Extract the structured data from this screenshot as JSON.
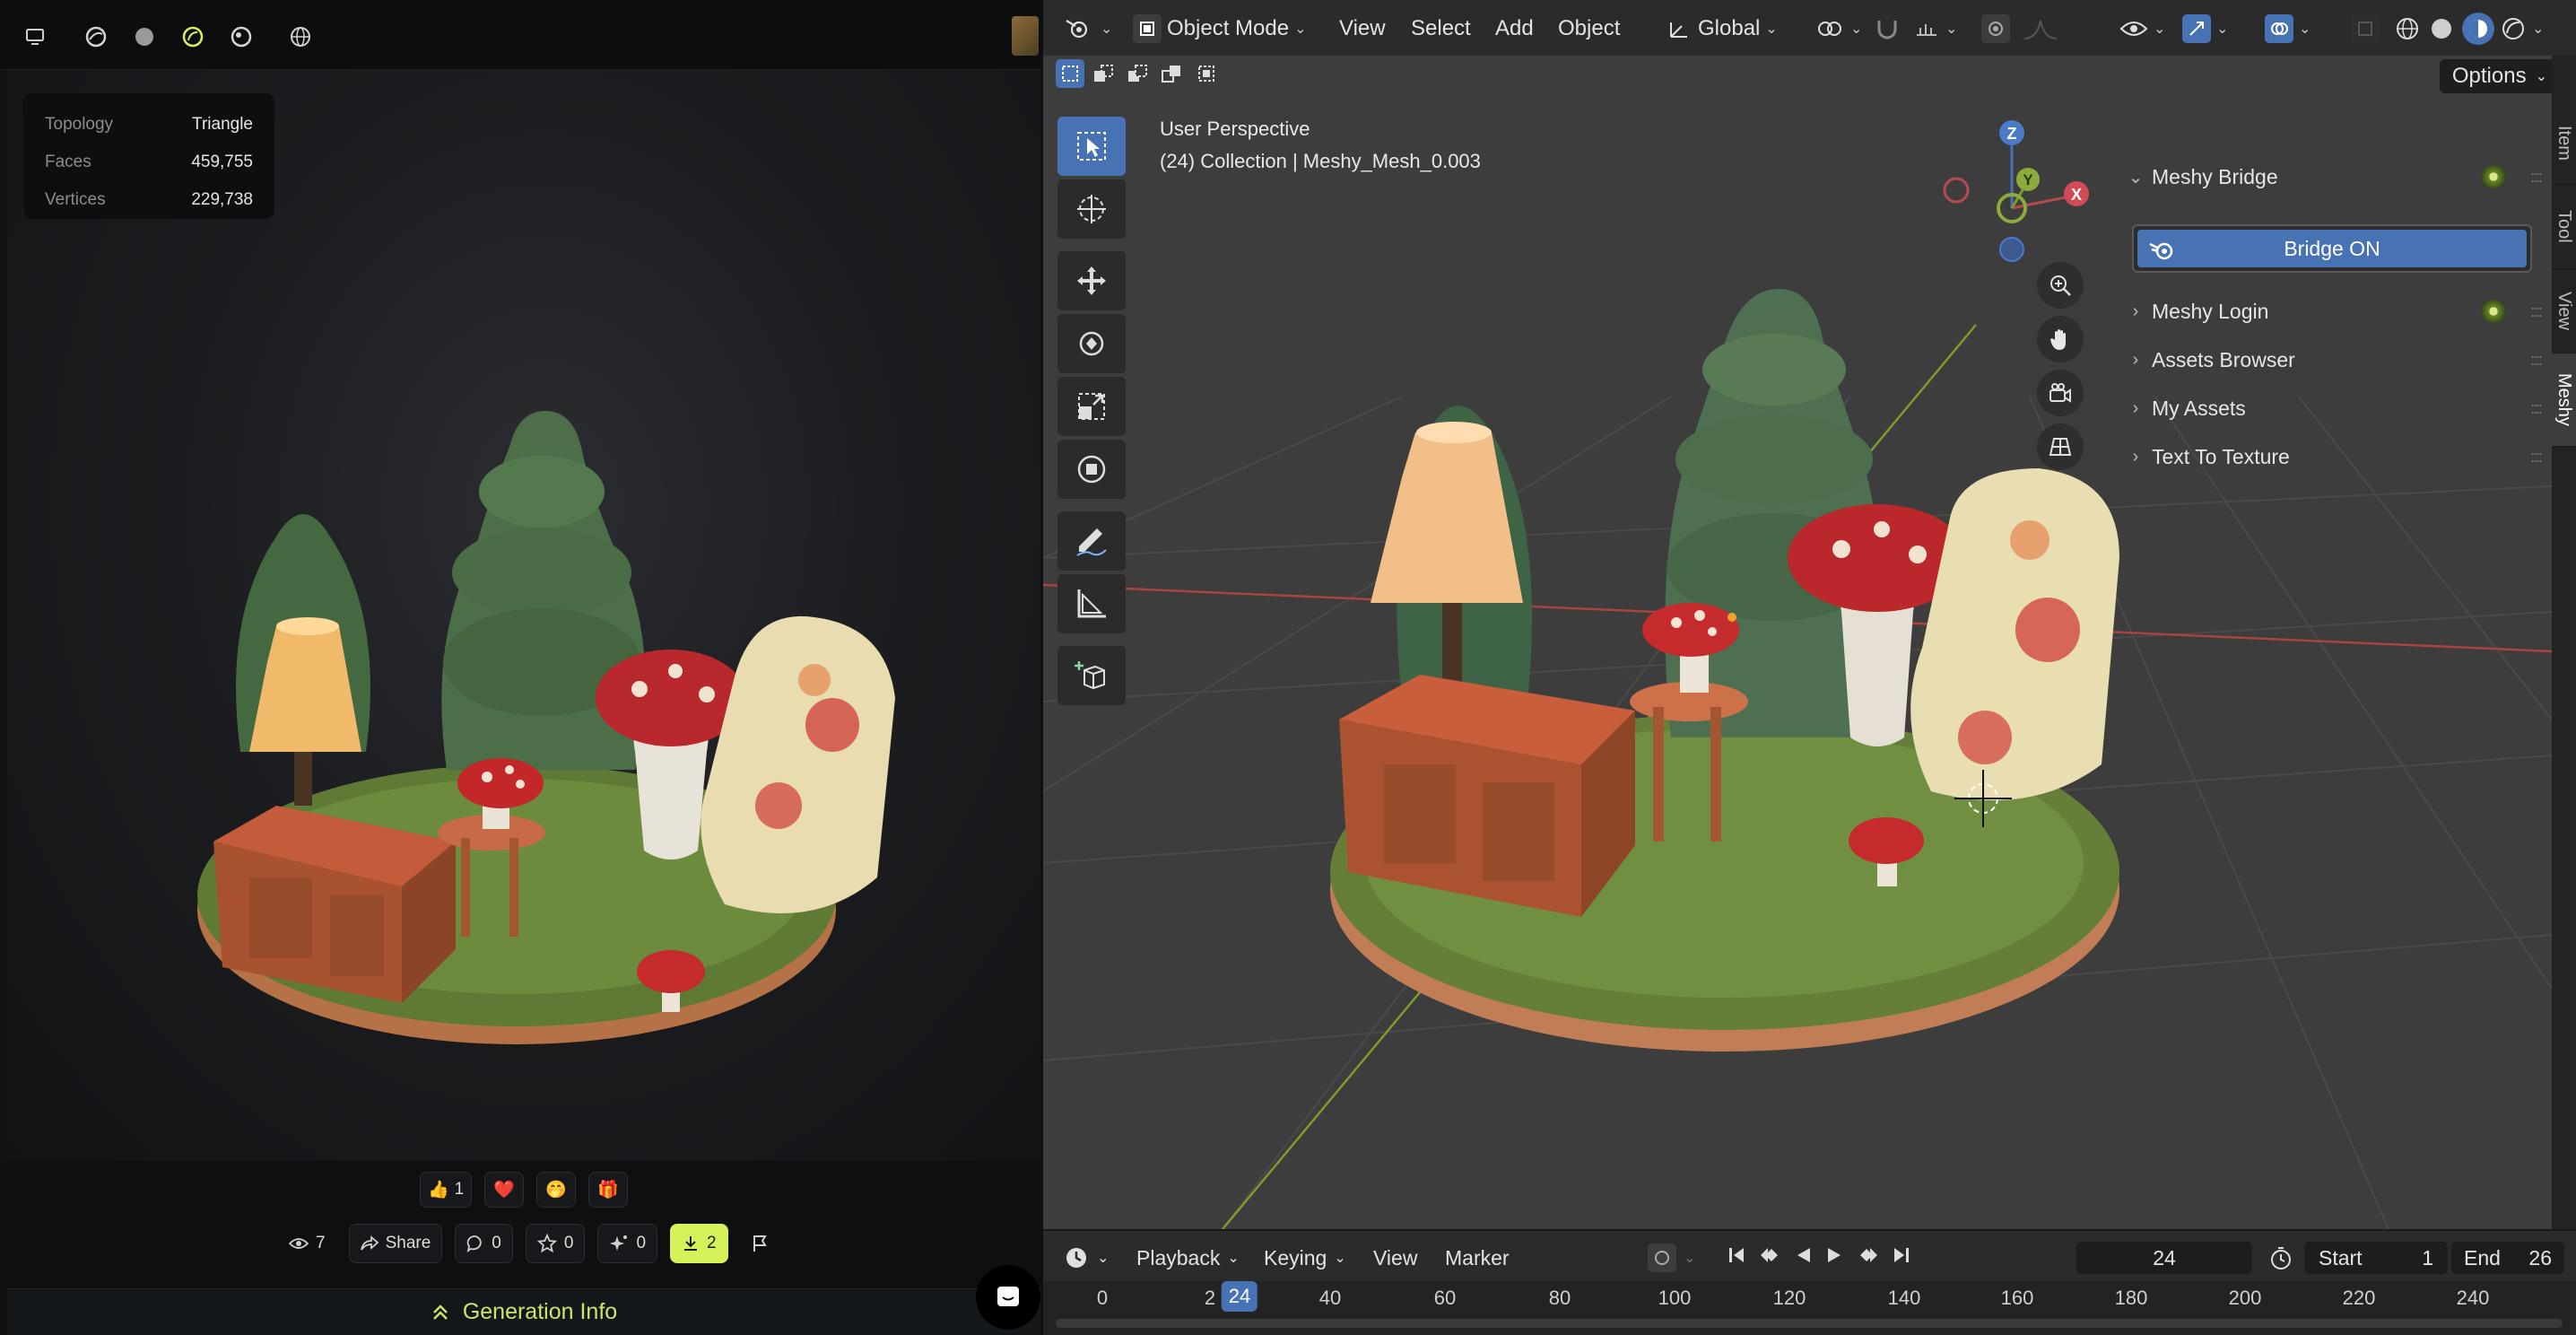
{
  "left": {
    "top_icons": [
      "monitor-icon",
      "render-mode-icon",
      "solid-mode-icon",
      "texture-mode-icon",
      "matcap-mode-icon",
      "wireframe-icon"
    ],
    "stats": [
      {
        "label": "Topology",
        "value": "Triangle"
      },
      {
        "label": "Faces",
        "value": "459,755"
      },
      {
        "label": "Vertices",
        "value": "229,738"
      }
    ],
    "reactions": [
      {
        "icon": "thumbs-up-icon",
        "glyph": "👍",
        "count": "1"
      },
      {
        "icon": "heart-icon",
        "glyph": "❤️",
        "count": ""
      },
      {
        "icon": "smile-icon",
        "glyph": "🤭",
        "count": ""
      },
      {
        "icon": "gift-icon",
        "glyph": "🎁",
        "count": ""
      }
    ],
    "actions": {
      "views": "7",
      "share": "Share",
      "comments": "0",
      "stars": "0",
      "remix": "0",
      "downloads": "2"
    },
    "generation_info": "Generation Info"
  },
  "blender": {
    "header": {
      "mode": "Object Mode",
      "menus": [
        "View",
        "Select",
        "Add",
        "Object"
      ],
      "orientation": "Global",
      "options": "Options"
    },
    "viewport": {
      "perspective": "User Perspective",
      "collection": "(24) Collection | Meshy_Mesh_0.003"
    },
    "gizmo": {
      "x": "X",
      "y": "Y",
      "z": "Z"
    },
    "npanel": {
      "panel_title": "Meshy Bridge",
      "bridge_button": "Bridge ON",
      "sections": [
        "Meshy Login",
        "Assets Browser",
        "My Assets",
        "Text To Texture"
      ]
    },
    "tabs": [
      "Item",
      "Tool",
      "View",
      "Meshy"
    ],
    "timeline": {
      "menus": [
        "Playback",
        "Keying",
        "View",
        "Marker"
      ],
      "current_frame": "24",
      "start_label": "Start",
      "start_value": "1",
      "end_label": "End",
      "end_value": "26",
      "ticks": [
        "0",
        "2",
        "40",
        "60",
        "80",
        "100",
        "120",
        "140",
        "160",
        "180",
        "200",
        "220",
        "240"
      ],
      "indicator": "24"
    }
  },
  "colors": {
    "accent_blue": "#4772b3",
    "download_lime": "#d6f25a",
    "gen_info_green": "#c9e86a"
  }
}
